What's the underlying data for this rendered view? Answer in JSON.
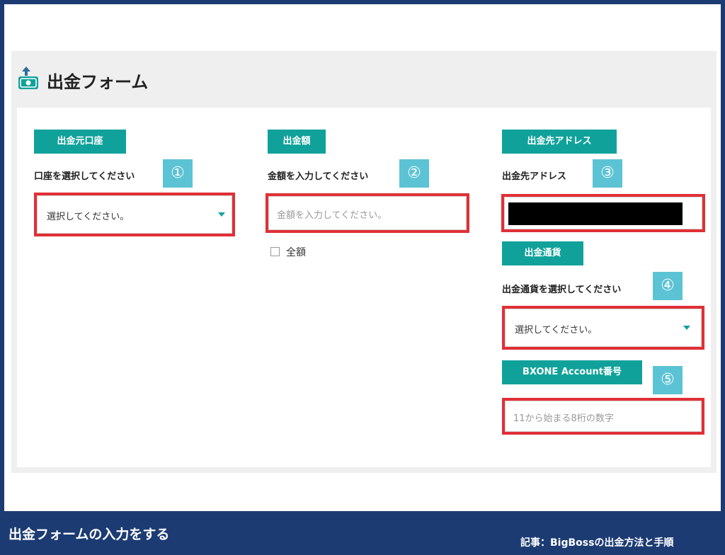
{
  "header": {
    "title": "出金フォーム",
    "icon": "money-withdraw-icon"
  },
  "col1": {
    "tag": "出金元口座",
    "label": "口座を選択してください",
    "step": "①",
    "select_value": "選択してください。"
  },
  "col2": {
    "tag": "出金額",
    "label": "金額を入力してください",
    "step": "②",
    "amount_placeholder": "金額を入力してください。",
    "full_amount_label": "全額"
  },
  "col3": {
    "tag": "出金先アドレス",
    "label": "出金先アドレス",
    "step": "③",
    "currency_tag": "出金通貨",
    "currency_label": "出金通貨を選択してください",
    "currency_step": "④",
    "currency_select_value": "選択してください。",
    "account_tag": "BXONE Account番号",
    "account_step": "⑤",
    "account_placeholder": "11から始まる8桁の数字"
  },
  "footer": {
    "caption": "出金フォームの入力をする",
    "source": "記事：BigBossの出金方法と手順"
  },
  "colors": {
    "accent": "#10a29a",
    "highlight": "#e12f36",
    "step_badge": "#5cc3d4",
    "frame": "#1c3b73"
  }
}
